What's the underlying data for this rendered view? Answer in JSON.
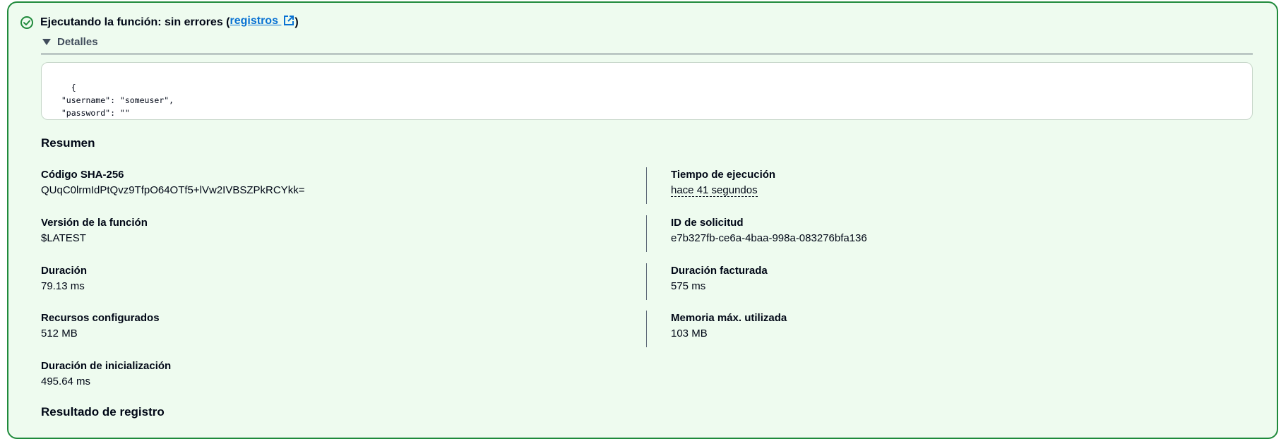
{
  "alert": {
    "status_text": "Ejecutando la función: sin errores (",
    "link_label": "registros",
    "close_paren": ")",
    "status_color": "#1f8a3b",
    "icon": "check-circle-icon"
  },
  "details": {
    "toggle_label": "Detalles",
    "payload": "{\n  \"username\": \"someuser\",\n  \"password\": \"\"\n}"
  },
  "summary": {
    "title": "Resumen",
    "left": [
      {
        "label": "Código SHA-256",
        "value": "QUqC0lrmIdPtQvz9TfpO64OTf5+lVw2IVBSZPkRCYkk="
      },
      {
        "label": "Versión de la función",
        "value": "$LATEST"
      },
      {
        "label": "Duración",
        "value": "79.13 ms"
      },
      {
        "label": "Recursos configurados",
        "value": "512 MB"
      },
      {
        "label": "Duración de inicialización",
        "value": "495.64 ms"
      }
    ],
    "right": [
      {
        "label": "Tiempo de ejecución",
        "value": "hace 41 segundos"
      },
      {
        "label": "ID de solicitud",
        "value": "e7b327fb-ce6a-4baa-998a-083276bfa136"
      },
      {
        "label": "Duración facturada",
        "value": "575 ms"
      },
      {
        "label": "Memoria máx. utilizada",
        "value": "103 MB"
      }
    ]
  },
  "log_result": {
    "title": "Resultado de registro"
  }
}
